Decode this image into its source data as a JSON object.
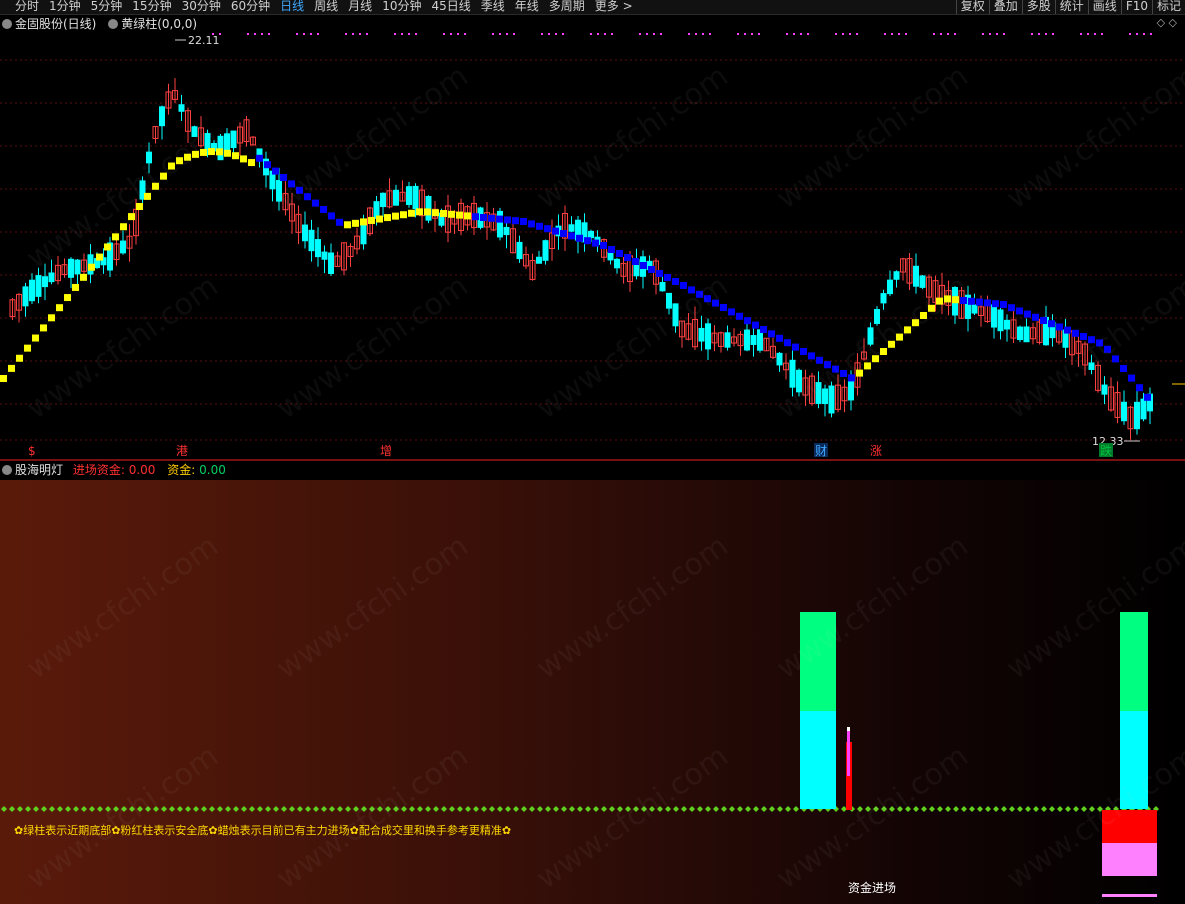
{
  "toolbar": {
    "periods": [
      "分时",
      "1分钟",
      "5分钟",
      "15分钟",
      "30分钟",
      "60分钟",
      "日线",
      "周线",
      "月线",
      "10分钟",
      "45日线",
      "季线",
      "年线",
      "多周期",
      "更多 >"
    ],
    "active_period": "日线",
    "tools": [
      "复权",
      "叠加",
      "多股",
      "统计",
      "画线",
      "F10",
      "标记"
    ]
  },
  "main_panel": {
    "stock_title": "金固股份(日线)",
    "indicator_title": "黄绿柱(0,0,0)",
    "high_label": "22.11",
    "low_label": "12.33",
    "event_markers": [
      {
        "text": "$",
        "color": "#ff3030"
      },
      {
        "text": "港",
        "color": "#ff3030"
      },
      {
        "text": "增",
        "color": "#ff3030"
      },
      {
        "text": "财",
        "color": "#3fa9ff"
      },
      {
        "text": "涨",
        "color": "#ff3030"
      },
      {
        "text": "跌",
        "color": "#00c040"
      }
    ],
    "top_icons": "◇ ◇"
  },
  "sub_panel": {
    "title": "股海明灯",
    "entry_fund_label": "进场资金:",
    "entry_fund_value": "0.00",
    "fund_label": "资金:",
    "fund_value": "0.00",
    "description": "✿绿柱表示近期底部✿粉红柱表示安全底✿蜡烛表示目前已有主力进场✿配合成交里和换手参考更精准✿",
    "capital_entry_label": "资金进场"
  },
  "colors": {
    "up": "#ff4040",
    "down": "#00ffff",
    "support_yellow": "#ffff00",
    "resist_blue": "#0000ff",
    "green_bar": "#00ff80",
    "cyan_bar": "#00ffff",
    "pink_bar": "#ff80ff",
    "red_bar": "#ff0000"
  },
  "watermark": "www.cfchi.com"
}
